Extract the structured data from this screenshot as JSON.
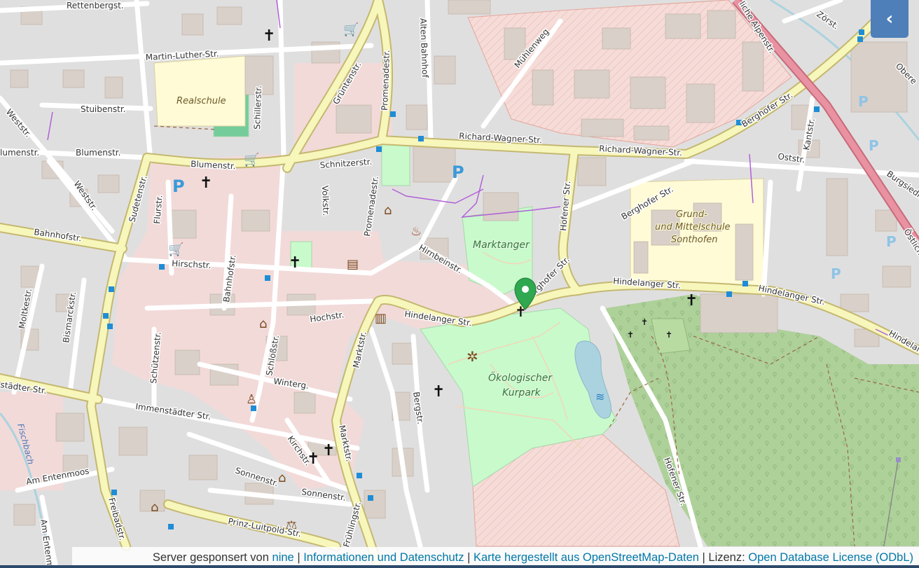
{
  "toggle": {
    "label": "‹",
    "icon": "chevron-left-icon"
  },
  "attribution": {
    "prefix": "Server gesponsert von",
    "sponsor_link": "nine",
    "sep1": "|",
    "info_link": "Informationen und Datenschutz",
    "sep2": "|",
    "data_link": "Karte hergestellt aus OpenStreetMap-Daten",
    "sep3": "| Lizenz:",
    "license_link": "Open Database License (ODbL)"
  },
  "marker": {
    "color": "#2fa84f",
    "icon": "map-marker-icon"
  },
  "colors": {
    "residential": "#e0dfdf",
    "commercial": "#f2dad9",
    "park": "#c8facc",
    "forest": "#aed19a",
    "school": "#fffbd6",
    "water": "#aad3df",
    "road_major": "#f7f6bb",
    "road_major_casing": "#c4b870",
    "motorway": "#e892a2",
    "building": "#d9d0c9",
    "accent": "#4e7fb8"
  },
  "labels": {
    "rettenberg": "Rettenbergst.",
    "martin_luther": "Martin-Luther-Str.",
    "realschule": "Realschule",
    "stuiben": "Stuibenstr.",
    "weststr1": "Weststr.",
    "blumenstr_w": "Blumenstr.",
    "blumenstr_w2": "lumenstr.",
    "blumenstr": "Blumenstr.",
    "schnitzer": "Schnitzerstr.",
    "gruenten": "Grüntenstr.",
    "promenade": "Promenadestr.",
    "alten_bahnhof": "Alten Bahnhof",
    "muehlenweg": "Mühlenweg",
    "schiller": "Schillerstr.",
    "richard_wagner1": "Richard-Wagner-Str.",
    "richard_wagner2": "Richard-Wagner-Str.",
    "berghofer1": "Berghofer Str.",
    "berghofer2": "Berghofer Str.",
    "berghofer3": "Berghofer Str.",
    "alpenstr": "Östliche Alpenstr.",
    "alpenstr_top": "liche Alpenstr.",
    "zoerst": "Zörst.",
    "obere": "Obere",
    "kantstr": "Kantstr.",
    "oststr": "Oststr.",
    "burgsied": "Burgsiedlu",
    "weststr2": "Weststr.",
    "sudeten": "Sudetenstr.",
    "flurstr": "Flurstr.",
    "volkstr": "Volkstr.",
    "promenade2": "Promenadestr.",
    "hofener1": "Hofener Str.",
    "hofener2": "Hofener Str.",
    "bahnhofstr": "Bahnhofstr.",
    "hirschstr": "Hirschstr.",
    "hirnbein": "Hirnbeinstr.",
    "marktanger": "Marktanger",
    "grund1": "Grund-",
    "grund2": "und Mittelschule",
    "grund3": "Sonthofen",
    "hindelanger1": "Hindelanger Str.",
    "hindelanger2": "Hindelanger Str.",
    "hindelanger3": "Hindelanger Str.",
    "hindelanger4": "Hindelan",
    "moltke": "Moltkestr.",
    "bismarck": "Bismarckstr.",
    "bahnhof2": "Bahnhofstr.",
    "hochstr": "Hochstr.",
    "marktstr1": "Marktstr.",
    "marktstr2": "Marktstr.",
    "schuetzen": "Schützenstr.",
    "schlosser": "Schloßstr.",
    "winterg": "Winterg.",
    "oekologischer": "Ökologischer",
    "kurpark": "Kurpark",
    "bergstr": "Bergstr.",
    "staedter": "städter Str.",
    "immenstaedter": "Immenstädter Str.",
    "fischbach": "Fischbach",
    "kirchstr": "Kirchstr.",
    "sonnenstr1": "Sonnenstr.",
    "sonnenstr2": "Sonnenstr.",
    "entenmoos": "Am Entenmoos",
    "entenmoos2": "Am Entenm",
    "freibad": "Freibadstr.",
    "prinz": "Prinz-Luitpold-Str.",
    "fruehling": "Frühlingstr."
  }
}
